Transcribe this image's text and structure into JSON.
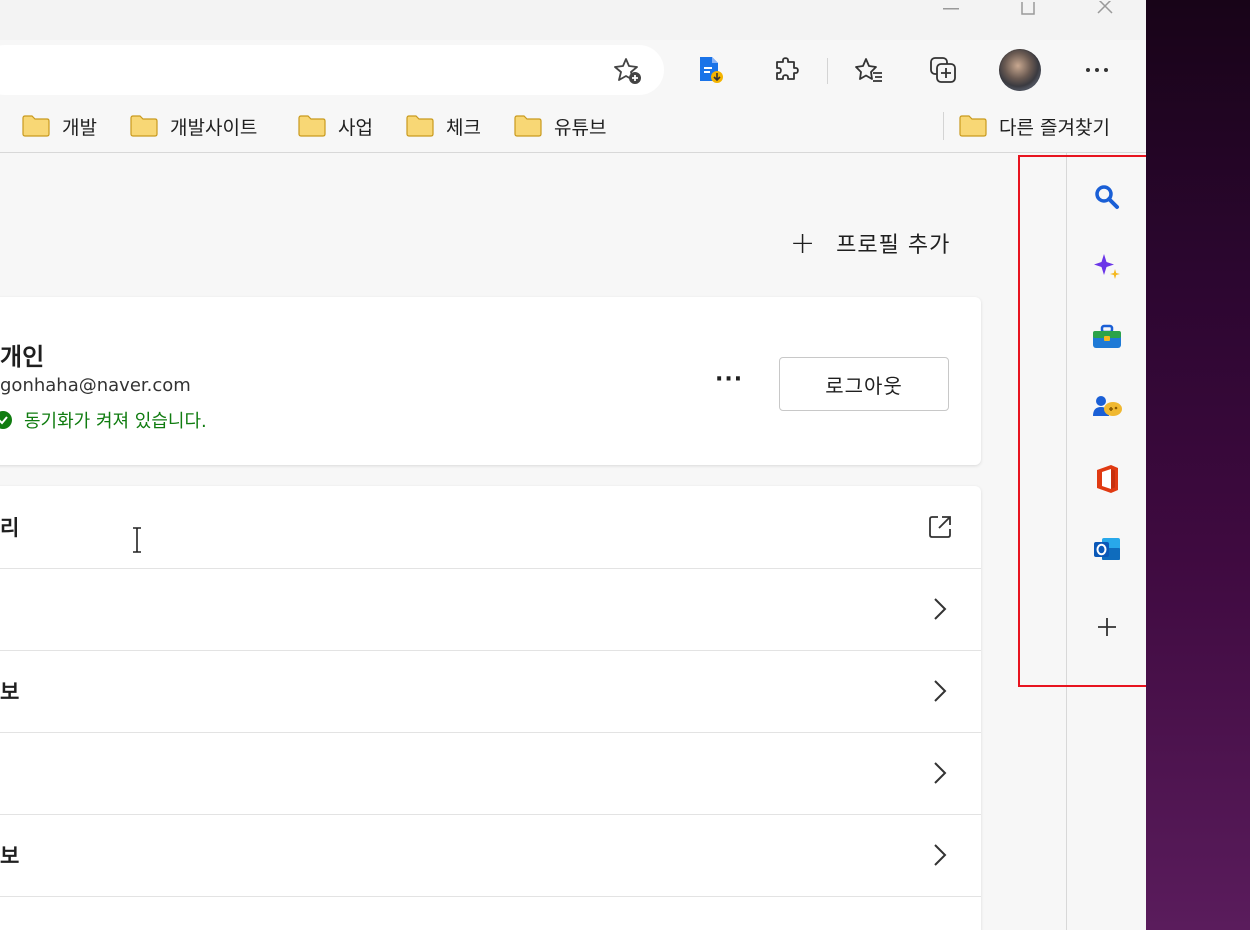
{
  "toolbar": {
    "favorite_icon": "star-add-icon",
    "icons": [
      "collection-download-icon",
      "extensions-icon",
      "favorites-icon",
      "collections-icon",
      "profile-avatar",
      "more-icon"
    ]
  },
  "bookmarks": [
    {
      "label": "개발"
    },
    {
      "label": "개발사이트"
    },
    {
      "label": "사업"
    },
    {
      "label": "체크"
    },
    {
      "label": "유튜브"
    }
  ],
  "other_bookmarks": "다른 즐겨찾기",
  "main": {
    "add_profile": "프로필 추가",
    "profile": {
      "name": "개인",
      "email": "gonhaha@naver.com",
      "sync_status": "동기화가 켜져 있습니다.",
      "more": "···",
      "logout": "로그아웃"
    },
    "rows": [
      {
        "label": "리",
        "icon": "external-link-icon"
      },
      {
        "label": "",
        "icon": "chevron-right-icon"
      },
      {
        "label": "보",
        "icon": "chevron-right-icon"
      },
      {
        "label": "",
        "icon": "chevron-right-icon"
      },
      {
        "label": "보",
        "icon": "chevron-right-icon"
      }
    ]
  },
  "sidebar": {
    "items": [
      "search-icon",
      "discover-icon",
      "tools-icon",
      "games-icon",
      "office-icon",
      "outlook-icon",
      "add-icon"
    ]
  },
  "colors": {
    "highlight": "#e8141f",
    "sync_green": "#107c10",
    "desktop": "#3f0a40"
  }
}
